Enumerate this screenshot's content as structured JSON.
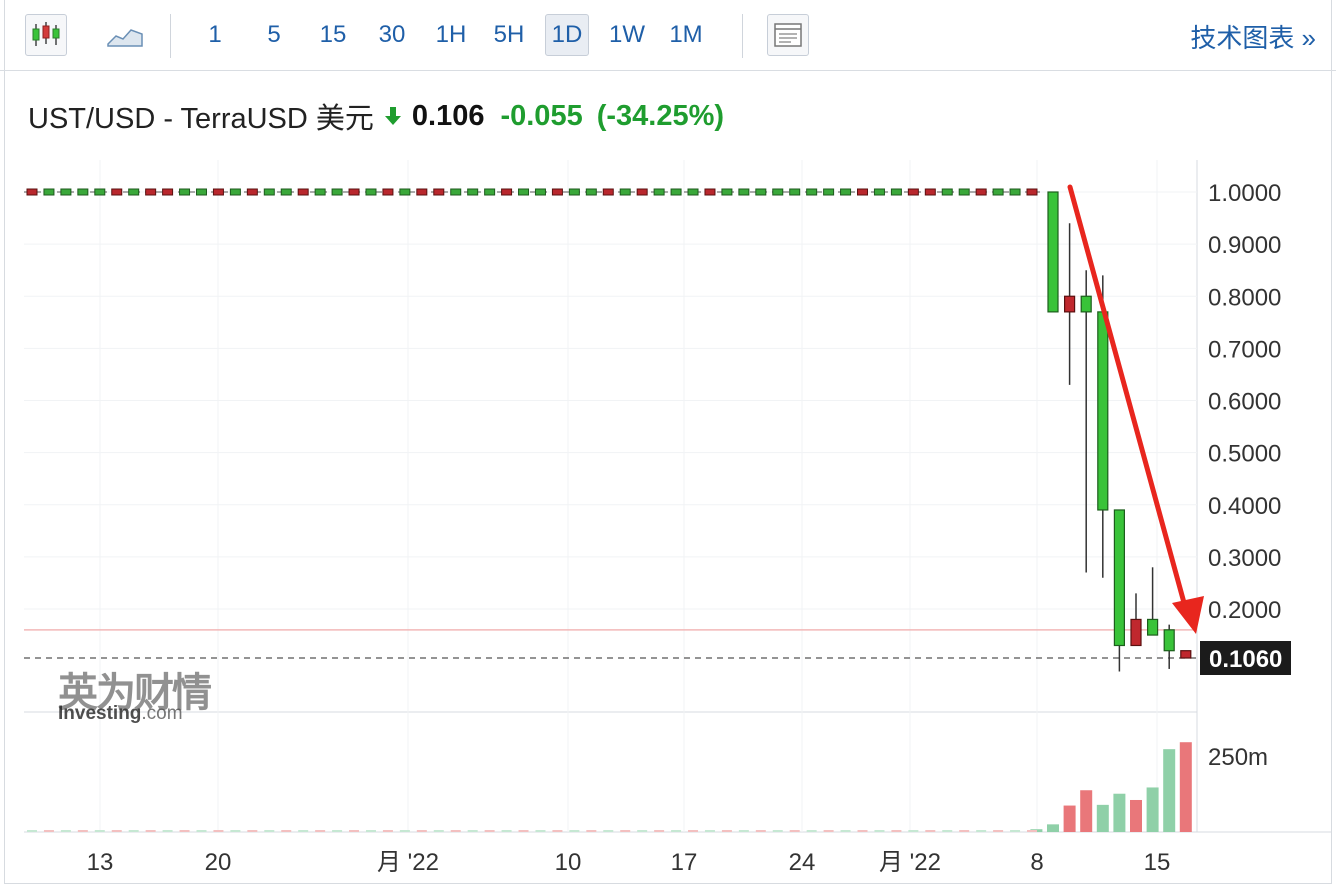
{
  "toolbar": {
    "intervals": [
      "1",
      "5",
      "15",
      "30",
      "1H",
      "5H",
      "1D",
      "1W",
      "1M"
    ],
    "active_interval": "1D",
    "tech_link": "技术图表 »"
  },
  "header": {
    "symbol": "UST/USD - TerraUSD 美元",
    "price": "0.106",
    "change": "-0.055",
    "change_pct": "(-34.25%)"
  },
  "watermark": {
    "brand_cn": "英为财情",
    "brand_en_a": "Investing",
    "brand_en_b": ".com"
  },
  "colors": {
    "up": "#39c339",
    "down": "#c0282e",
    "accent": "#1f5fa8",
    "arrow": "#e8261e",
    "vol_up": "#8fd0a8",
    "vol_down": "#e9777a"
  },
  "chart_data": {
    "type": "candlestick",
    "y_ticks": [
      "1.0000",
      "0.9000",
      "0.8000",
      "0.7000",
      "0.6000",
      "0.5000",
      "0.4000",
      "0.3000",
      "0.2000"
    ],
    "last_price_label": "0.1060",
    "ylim": [
      0.04,
      1.05
    ],
    "x_tick_labels": [
      "13",
      "20",
      "月 '22",
      "10",
      "17",
      "24",
      "月 '22",
      "8",
      "15"
    ],
    "volume_tick": "250m",
    "flat_candles": {
      "count": 60,
      "value": 1.0,
      "colors": [
        "r",
        "g",
        "g",
        "g",
        "g",
        "r",
        "g",
        "r",
        "r",
        "g",
        "g",
        "r",
        "g",
        "r",
        "g",
        "g",
        "r",
        "g",
        "g",
        "r",
        "g",
        "r",
        "g",
        "r",
        "r",
        "g",
        "g",
        "g",
        "r",
        "g",
        "g",
        "r",
        "g",
        "g",
        "r",
        "g",
        "r",
        "g",
        "g",
        "g",
        "r",
        "g",
        "g",
        "g",
        "g",
        "g",
        "g",
        "g",
        "g",
        "r",
        "g",
        "g",
        "r",
        "r",
        "g",
        "g",
        "r",
        "g",
        "g",
        "r"
      ]
    },
    "candles": [
      {
        "date": "8",
        "open": 1.0,
        "high": 1.0,
        "low": 0.77,
        "close": 0.77,
        "dir": "down"
      },
      {
        "date": "9",
        "open": 0.77,
        "high": 0.94,
        "low": 0.63,
        "close": 0.8,
        "dir": "up"
      },
      {
        "date": "10",
        "open": 0.8,
        "high": 0.85,
        "low": 0.27,
        "close": 0.77,
        "dir": "down"
      },
      {
        "date": "11",
        "open": 0.77,
        "high": 0.84,
        "low": 0.26,
        "close": 0.39,
        "dir": "down"
      },
      {
        "date": "12",
        "open": 0.39,
        "high": 0.39,
        "low": 0.08,
        "close": 0.13,
        "dir": "down"
      },
      {
        "date": "13",
        "open": 0.13,
        "high": 0.23,
        "low": 0.13,
        "close": 0.18,
        "dir": "up"
      },
      {
        "date": "14",
        "open": 0.18,
        "high": 0.28,
        "low": 0.15,
        "close": 0.15,
        "dir": "down"
      },
      {
        "date": "15",
        "open": 0.16,
        "high": 0.17,
        "low": 0.085,
        "close": 0.12,
        "dir": "down"
      },
      {
        "date": "16",
        "open": 0.12,
        "high": 0.12,
        "low": 0.106,
        "close": 0.106,
        "dir": "up"
      }
    ],
    "volume_max": 250,
    "volumes": [
      {
        "date": "7",
        "value": 8,
        "dir": "up"
      },
      {
        "date": "8",
        "value": 22,
        "dir": "up"
      },
      {
        "date": "9",
        "value": 76,
        "dir": "down"
      },
      {
        "date": "10",
        "value": 120,
        "dir": "down"
      },
      {
        "date": "11",
        "value": 78,
        "dir": "up"
      },
      {
        "date": "12",
        "value": 110,
        "dir": "up"
      },
      {
        "date": "13",
        "value": 92,
        "dir": "down"
      },
      {
        "date": "14",
        "value": 128,
        "dir": "up"
      },
      {
        "date": "15",
        "value": 238,
        "dir": "up"
      },
      {
        "date": "16",
        "value": 258,
        "dir": "down"
      }
    ],
    "reference_line": 0.16
  }
}
